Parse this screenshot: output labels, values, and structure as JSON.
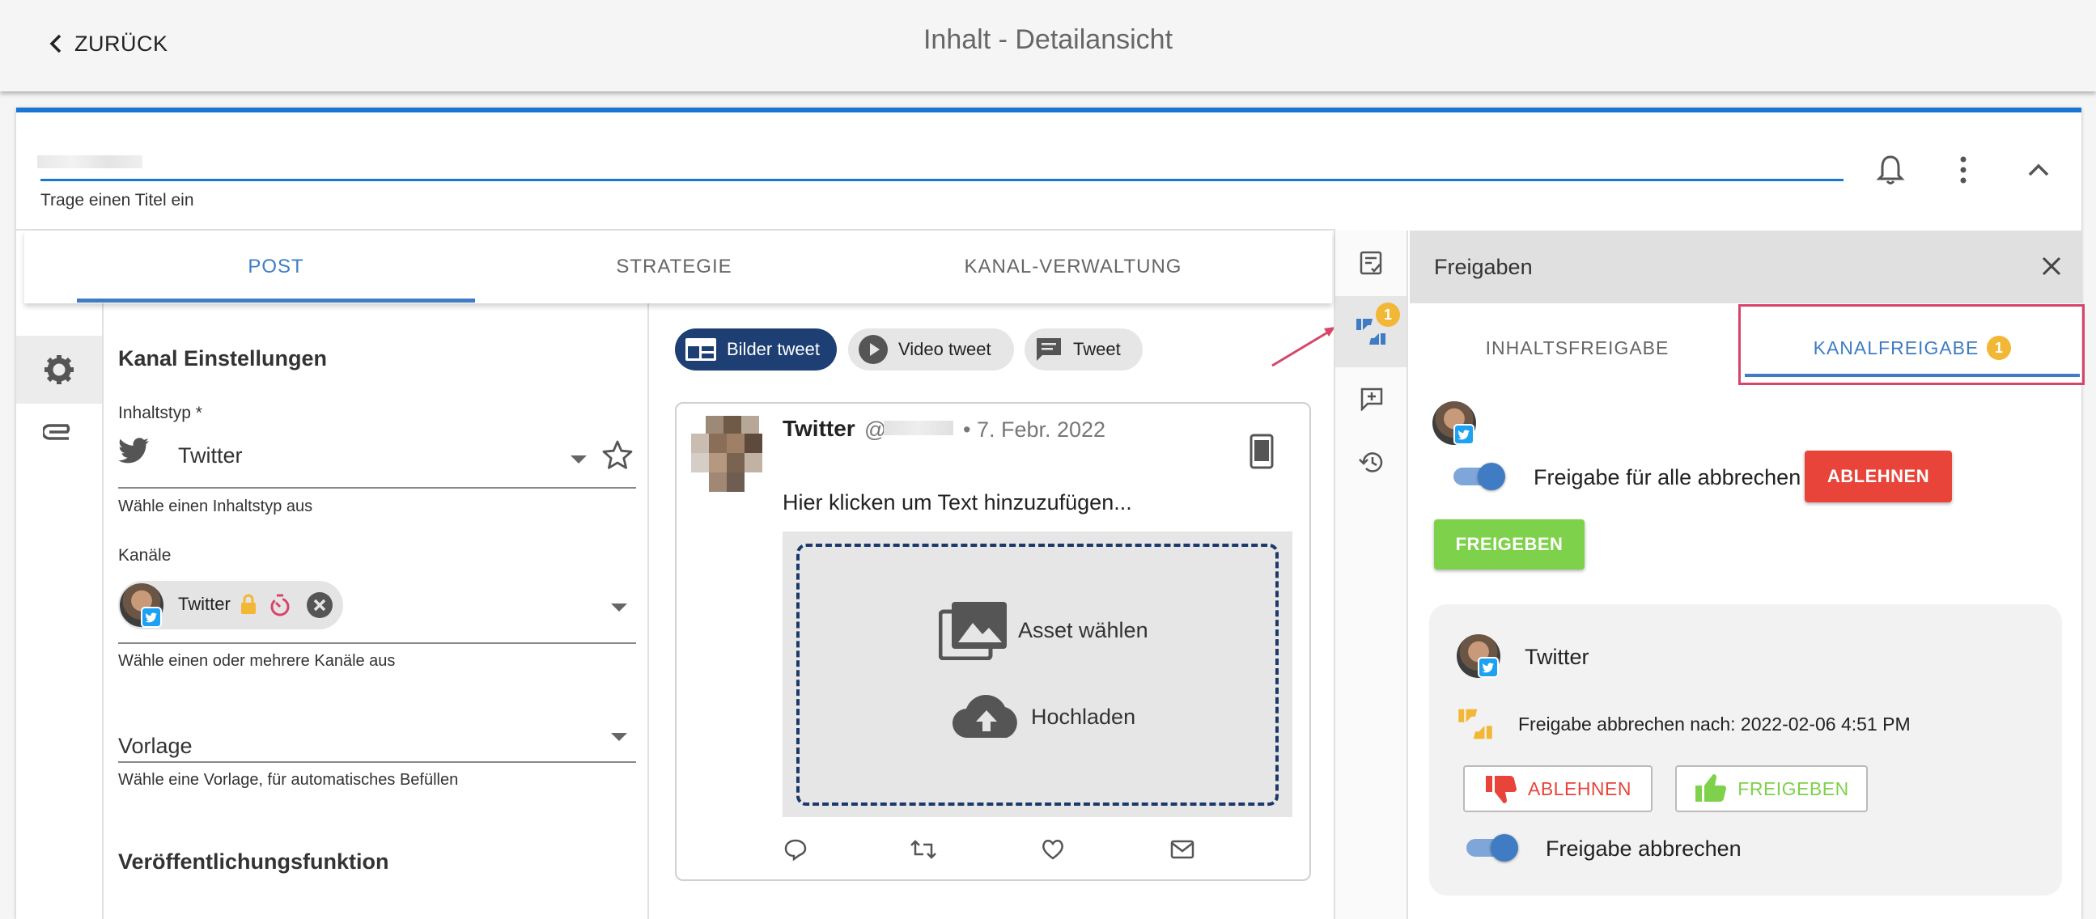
{
  "header": {
    "back_label": "ZURÜCK",
    "title": "Inhalt - Detailansicht"
  },
  "title_field": {
    "helper": "Trage einen Titel ein"
  },
  "tabs": [
    {
      "label": "POST",
      "active": true
    },
    {
      "label": "STRATEGIE",
      "active": false
    },
    {
      "label": "KANAL-VERWALTUNG",
      "active": false
    }
  ],
  "settings": {
    "heading": "Kanal Einstellungen",
    "content_type": {
      "label": "Inhaltstyp *",
      "value": "Twitter",
      "helper": "Wähle einen Inhaltstyp aus"
    },
    "channels": {
      "label": "Kanäle",
      "chip_label": "Twitter",
      "helper": "Wähle einen oder mehrere Kanäle aus"
    },
    "template": {
      "label": "Vorlage",
      "helper": "Wähle eine Vorlage, für automatisches Befüllen"
    },
    "publish_heading": "Veröffentlichungsfunktion"
  },
  "preview": {
    "types": [
      {
        "label": "Bilder tweet",
        "active": true
      },
      {
        "label": "Video tweet",
        "active": false
      },
      {
        "label": "Tweet",
        "active": false
      }
    ],
    "tweet": {
      "name": "Twitter",
      "handle": "@",
      "date": "• 7. Febr. 2022",
      "placeholder": "Hier klicken um Text hinzuzufügen...",
      "asset_label": "Asset wählen",
      "upload_label": "Hochladen"
    }
  },
  "side_rail": {
    "approval_badge": "1"
  },
  "panel": {
    "title": "Freigaben",
    "tabs": [
      {
        "label": "INHALTSFREIGABE",
        "active": false
      },
      {
        "label": "KANALFREIGABE",
        "active": true,
        "badge": "1"
      }
    ],
    "cancel_all_label": "Freigabe für alle abbrechen",
    "reject_label": "ABLEHNEN",
    "approve_label": "FREIGEBEN",
    "channel": {
      "name": "Twitter",
      "cancel_after": "Freigabe abbrechen nach: 2022-02-06 4:51 PM",
      "reject_label": "ABLEHNEN",
      "approve_label": "FREIGEBEN",
      "cancel_label": "Freigabe abbrechen"
    }
  },
  "colors": {
    "primary": "#3f7cc4",
    "reject": "#e8443a",
    "approve": "#7ed14a",
    "badge": "#f2b735",
    "highlight": "#d6456a"
  }
}
